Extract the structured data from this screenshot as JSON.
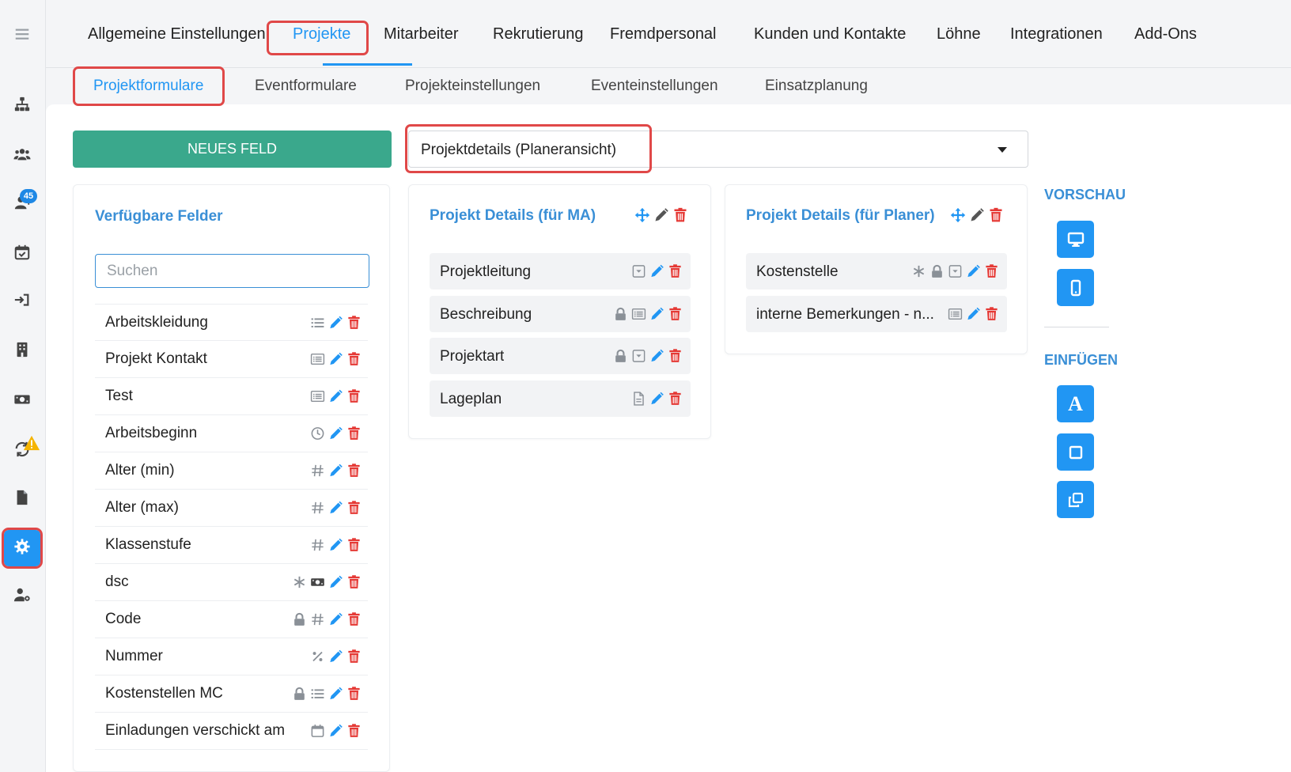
{
  "colors": {
    "accent": "#2196f3",
    "primary_button": "#3aa88c",
    "highlight": "#e04848",
    "delete": "#e53935",
    "title": "#3a8fd6"
  },
  "sidebar": {
    "items": [
      {
        "icon": "menu-icon"
      },
      {
        "icon": "sitemap-icon"
      },
      {
        "icon": "users-icon"
      },
      {
        "icon": "add-user-icon",
        "badge": "45"
      },
      {
        "icon": "calendar-check-icon"
      },
      {
        "icon": "sign-in-icon"
      },
      {
        "icon": "building-icon"
      },
      {
        "icon": "money-icon"
      },
      {
        "icon": "sync-icon",
        "warning": true
      },
      {
        "icon": "file-icon"
      },
      {
        "icon": "gear-icon",
        "active": true
      },
      {
        "icon": "user-cog-icon"
      }
    ]
  },
  "topnav": {
    "tabs": [
      {
        "label": "Allgemeine Einstellungen"
      },
      {
        "label": "Projekte",
        "active": true
      },
      {
        "label": "Mitarbeiter"
      },
      {
        "label": "Rekrutierung"
      },
      {
        "label": "Fremdpersonal"
      },
      {
        "label": "Kunden und Kontakte"
      },
      {
        "label": "Löhne"
      },
      {
        "label": "Integrationen"
      },
      {
        "label": "Add-Ons"
      }
    ]
  },
  "subnav": {
    "tabs": [
      {
        "label": "Projektformulare",
        "active": true
      },
      {
        "label": "Eventformulare"
      },
      {
        "label": "Projekteinstellungen"
      },
      {
        "label": "Eventeinstellungen"
      },
      {
        "label": "Einsatzplanung"
      }
    ]
  },
  "toolbar": {
    "new_field_label": "NEUES FELD",
    "form_select_value": "Projektdetails (Planeransicht)"
  },
  "available": {
    "title": "Verfügbare Felder",
    "search_placeholder": "Suchen",
    "fields": [
      {
        "label": "Arbeitskleidung",
        "icons": [
          "list-icon"
        ]
      },
      {
        "label": "Projekt Kontakt",
        "icons": [
          "textarea-icon"
        ]
      },
      {
        "label": "Test",
        "icons": [
          "textarea-icon"
        ]
      },
      {
        "label": "Arbeitsbeginn",
        "icons": [
          "clock-icon"
        ]
      },
      {
        "label": "Alter (min)",
        "icons": [
          "hash-icon"
        ]
      },
      {
        "label": "Alter (max)",
        "icons": [
          "hash-icon"
        ]
      },
      {
        "label": "Klassenstufe",
        "icons": [
          "hash-icon"
        ]
      },
      {
        "label": "dsc",
        "icons": [
          "asterisk-icon",
          "money-icon"
        ]
      },
      {
        "label": "Code",
        "icons": [
          "lock-icon",
          "hash-icon"
        ]
      },
      {
        "label": "Nummer",
        "icons": [
          "percent-icon"
        ]
      },
      {
        "label": "Kostenstellen MC",
        "icons": [
          "lock-icon",
          "list-icon"
        ]
      },
      {
        "label": "Einladungen verschickt am",
        "icons": [
          "calendar-icon"
        ]
      }
    ]
  },
  "ma_section": {
    "title": "Projekt Details (für MA)",
    "fields": [
      {
        "label": "Projektleitung",
        "icons": [
          "dropdown-icon"
        ]
      },
      {
        "label": "Beschreibung",
        "icons": [
          "lock-icon",
          "textarea-icon"
        ]
      },
      {
        "label": "Projektart",
        "icons": [
          "lock-icon",
          "dropdown-icon"
        ]
      },
      {
        "label": "Lageplan",
        "icons": [
          "document-icon"
        ]
      }
    ]
  },
  "planer_section": {
    "title": "Projekt Details (für Planer)",
    "fields": [
      {
        "label": "Kostenstelle",
        "icons": [
          "asterisk-icon",
          "lock-icon",
          "dropdown-icon"
        ]
      },
      {
        "label": "interne Bemerkungen - n...",
        "icons": [
          "textarea-icon"
        ]
      }
    ]
  },
  "side": {
    "preview_label": "VORSCHAU",
    "insert_label": "EINFÜGEN",
    "insert_text_glyph": "A"
  }
}
